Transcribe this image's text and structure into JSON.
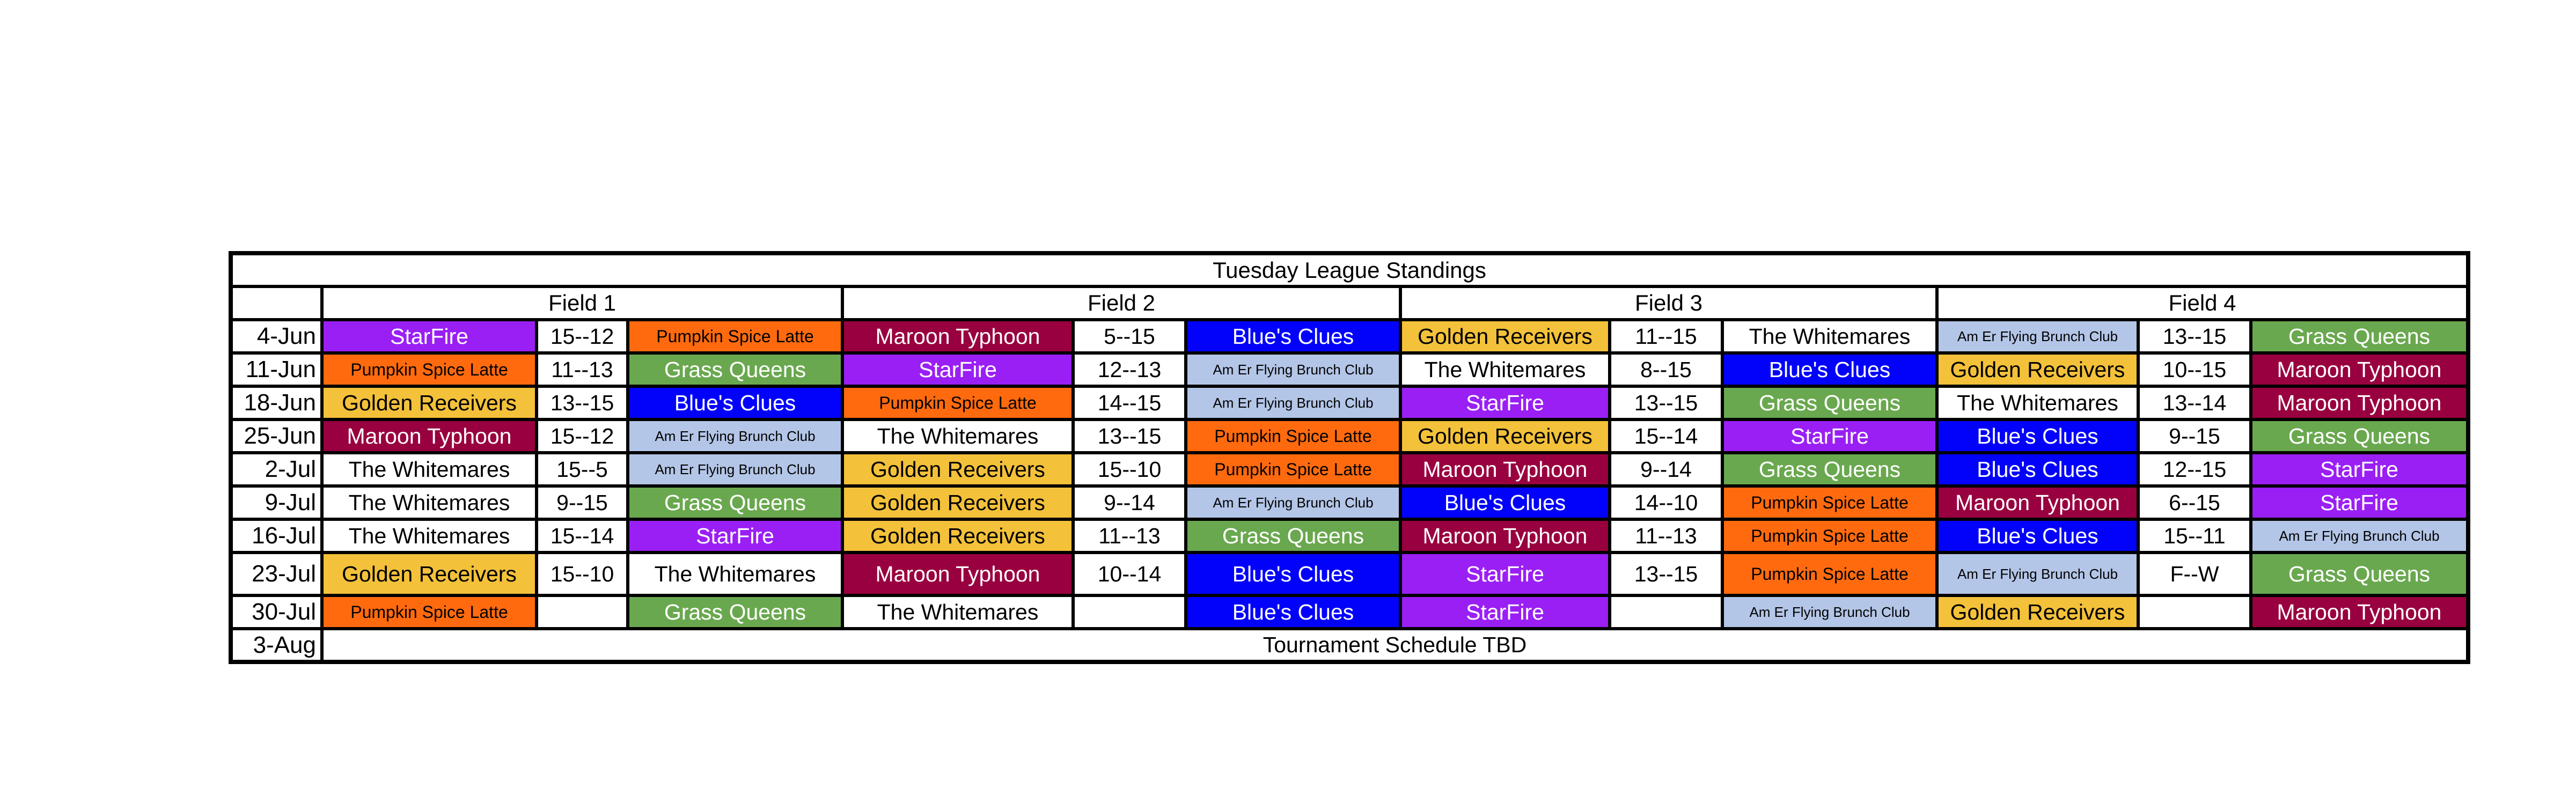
{
  "title": "Tuesday League Standings",
  "fields": [
    "Field 1",
    "Field 2",
    "Field 3",
    "Field 4"
  ],
  "colors": {
    "StarFire": "#9a1ff4",
    "Pumpkin Spice Latte": "#ff6a0e",
    "Grass Queens": "#6aa84f",
    "Maroon Typhoon": "#99003f",
    "Blue's Clues": "#0202fb",
    "Golden Receivers": "#f3c13a",
    "Am Er Flying Brunch Club": "#b4c6e7",
    "The Whitemares": "#ffffff"
  },
  "rows": [
    {
      "date": "4-Jun",
      "games": [
        {
          "home": "StarFire",
          "score": "15--12",
          "away": "Pumpkin Spice Latte"
        },
        {
          "home": "Maroon Typhoon",
          "score": "5--15",
          "away": "Blue's Clues"
        },
        {
          "home": "Golden Receivers",
          "score": "11--15",
          "away": "The Whitemares"
        },
        {
          "home": "Am Er Flying Brunch Club",
          "score": "13--15",
          "away": "Grass Queens"
        }
      ]
    },
    {
      "date": "11-Jun",
      "games": [
        {
          "home": "Pumpkin Spice Latte",
          "score": "11--13",
          "away": "Grass Queens"
        },
        {
          "home": "StarFire",
          "score": "12--13",
          "away": "Am Er Flying Brunch Club"
        },
        {
          "home": "The Whitemares",
          "score": "8--15",
          "away": "Blue's Clues"
        },
        {
          "home": "Golden Receivers",
          "score": "10--15",
          "away": "Maroon Typhoon"
        }
      ]
    },
    {
      "date": "18-Jun",
      "games": [
        {
          "home": "Golden Receivers",
          "score": "13--15",
          "away": "Blue's Clues"
        },
        {
          "home": "Pumpkin Spice Latte",
          "score": "14--15",
          "away": "Am Er Flying Brunch Club"
        },
        {
          "home": "StarFire",
          "score": "13--15",
          "away": "Grass Queens"
        },
        {
          "home": "The Whitemares",
          "score": "13--14",
          "away": "Maroon Typhoon"
        }
      ]
    },
    {
      "date": "25-Jun",
      "games": [
        {
          "home": "Maroon Typhoon",
          "score": "15--12",
          "away": "Am Er Flying Brunch Club"
        },
        {
          "home": "The Whitemares",
          "score": "13--15",
          "away": "Pumpkin Spice Latte"
        },
        {
          "home": "Golden Receivers",
          "score": "15--14",
          "away": "StarFire"
        },
        {
          "home": "Blue's Clues",
          "score": "9--15",
          "away": "Grass Queens"
        }
      ]
    },
    {
      "date": "2-Jul",
      "games": [
        {
          "home": "The Whitemares",
          "score": "15--5",
          "away": "Am Er Flying Brunch Club"
        },
        {
          "home": "Golden Receivers",
          "score": "15--10",
          "away": "Pumpkin Spice Latte"
        },
        {
          "home": "Maroon Typhoon",
          "score": "9--14",
          "away": "Grass Queens"
        },
        {
          "home": "Blue's Clues",
          "score": "12--15",
          "away": "StarFire"
        }
      ]
    },
    {
      "date": "9-Jul",
      "games": [
        {
          "home": "The Whitemares",
          "score": "9--15",
          "away": "Grass Queens"
        },
        {
          "home": "Golden Receivers",
          "score": "9--14",
          "away": "Am Er Flying Brunch Club"
        },
        {
          "home": "Blue's Clues",
          "score": "14--10",
          "away": "Pumpkin Spice Latte"
        },
        {
          "home": "Maroon Typhoon",
          "score": "6--15",
          "away": "StarFire"
        }
      ]
    },
    {
      "date": "16-Jul",
      "games": [
        {
          "home": "The Whitemares",
          "score": "15--14",
          "away": "StarFire"
        },
        {
          "home": "Golden Receivers",
          "score": "11--13",
          "away": "Grass Queens"
        },
        {
          "home": "Maroon Typhoon",
          "score": "11--13",
          "away": "Pumpkin Spice Latte"
        },
        {
          "home": "Blue's Clues",
          "score": "15--11",
          "away": "Am Er Flying Brunch Club"
        }
      ]
    },
    {
      "date": "23-Jul",
      "games": [
        {
          "home": "Golden Receivers",
          "score": "15--10",
          "away": "The Whitemares"
        },
        {
          "home": "Maroon Typhoon",
          "score": "10--14",
          "away": "Blue's Clues"
        },
        {
          "home": "StarFire",
          "score": "13--15",
          "away": "Pumpkin Spice Latte"
        },
        {
          "home": "Am Er Flying Brunch Club",
          "score": "F--W",
          "away": "Grass Queens"
        }
      ]
    },
    {
      "date": "30-Jul",
      "games": [
        {
          "home": "Pumpkin Spice Latte",
          "score": "",
          "away": "Grass Queens"
        },
        {
          "home": "The Whitemares",
          "score": "",
          "away": "Blue's Clues"
        },
        {
          "home": "StarFire",
          "score": "",
          "away": "Am Er Flying Brunch Club"
        },
        {
          "home": "Golden Receivers",
          "score": "",
          "away": "Maroon Typhoon"
        }
      ]
    }
  ],
  "footer": {
    "date": "3-Aug",
    "text": "Tournament Schedule TBD"
  }
}
